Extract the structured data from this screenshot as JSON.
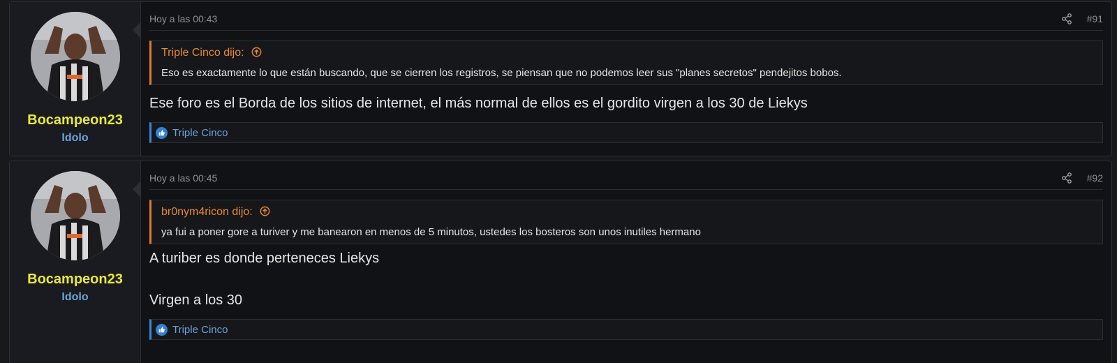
{
  "posts": [
    {
      "username": "Bocampeon23",
      "user_title": "Idolo",
      "date": "Hoy a las 00:43",
      "post_number": "#91",
      "quote": {
        "title": "Triple Cinco dijo:",
        "body": "Eso es exactamente lo que están buscando, que se cierren los registros, se piensan que no podemos leer sus \"planes secretos\" pendejitos bobos."
      },
      "content": [
        "Ese foro es el Borda de los sitios de internet, el más normal de ellos es el gordito virgen a los 30 de Liekys"
      ],
      "reactions": "Triple Cinco"
    },
    {
      "username": "Bocampeon23",
      "user_title": "Idolo",
      "date": "Hoy a las 00:45",
      "post_number": "#92",
      "quote": {
        "title": "br0nym4ricon dijo:",
        "body": "ya fui a poner gore a turiver y me banearon en menos de 5 minutos, ustedes los bosteros son unos inutiles hermano"
      },
      "content": [
        "A turiber es donde perteneces Liekys",
        "Virgen a los 30"
      ],
      "reactions": "Triple Cinco"
    }
  ],
  "colors": {
    "username": "#e8e83a",
    "user_title": "#6fa2d6",
    "quote_accent": "#e07a2c",
    "reaction_accent": "#3c86d6"
  },
  "icons": [
    "share-icon",
    "arrow-up-circle-icon",
    "like-icon",
    "avatar-image"
  ]
}
